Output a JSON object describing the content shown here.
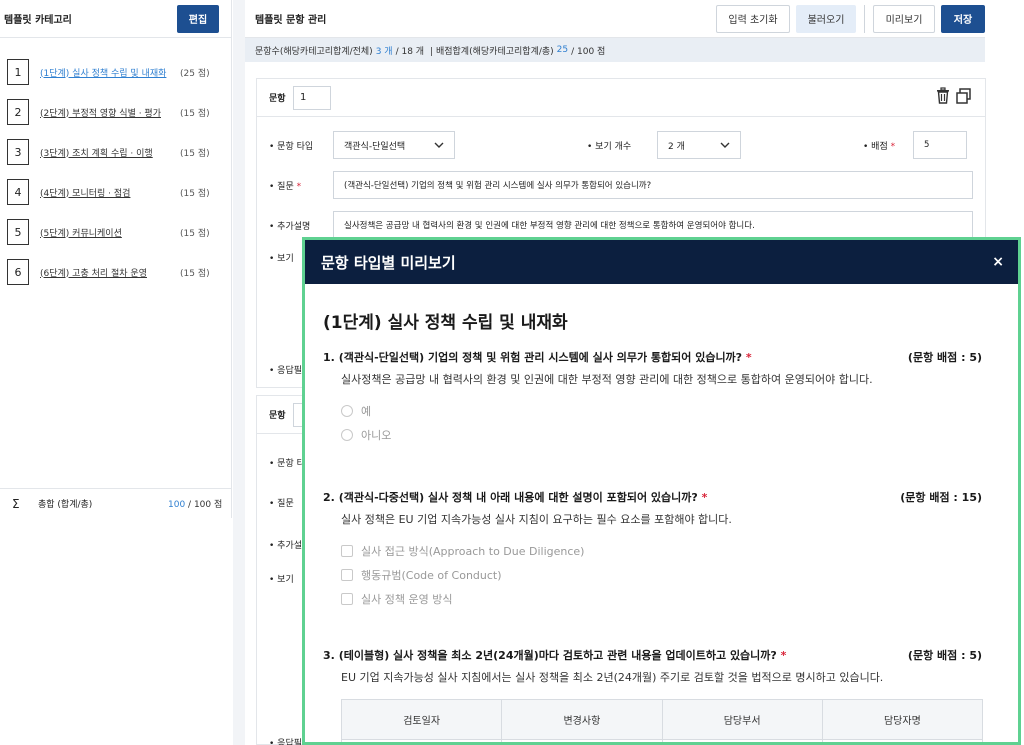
{
  "left": {
    "title": "템플릿 카테고리",
    "edit_label": "편집",
    "categories": [
      {
        "num": "1",
        "label": "(1단계) 실사 정책 수립 및 내재화",
        "score": "(25 점)"
      },
      {
        "num": "2",
        "label": "(2단계) 부정적 영향 식별 · 평가",
        "score": "(15 점)"
      },
      {
        "num": "3",
        "label": "(3단계) 조치 계획 수립 · 이행",
        "score": "(15 점)"
      },
      {
        "num": "4",
        "label": "(4단계) 모니터링 · 점검",
        "score": "(15 점)"
      },
      {
        "num": "5",
        "label": "(5단계) 커뮤니케이션",
        "score": "(15 점)"
      },
      {
        "num": "6",
        "label": "(6단계) 고충 처리 절차 운영",
        "score": "(15 점)"
      }
    ],
    "total_symbol": "Σ",
    "total_label": "총합 (합계/총)",
    "total_current": "100",
    "total_rest": " / 100 점"
  },
  "main": {
    "title": "템플릿 문항 관리",
    "btn_reset": "입력 초기화",
    "btn_load": "불러오기",
    "btn_preview": "미리보기",
    "btn_save": "저장",
    "summary": {
      "count_label": "문항수(해당카테고리합계/전체)",
      "count_current": "3 개",
      "count_rest": "/ 18 개",
      "score_label": "| 배점합계(해당카테고리합계/총)",
      "score_current": "25",
      "score_rest": "/ 100 점"
    },
    "question": {
      "num_label": "문항",
      "num_value": "1",
      "type_label": "• 문항 타입",
      "type_value": "객관식-단일선택",
      "options_label": "• 보기 개수",
      "options_value": "2 개",
      "score_label": "• 배점",
      "score_value": "5",
      "question_label": "• 질문",
      "question_value": "(객관식-단일선택) 기업의 정책 및 위험 관리 시스템에 실사 의무가 통합되어 있습니까?",
      "extra_label": "• 추가설명",
      "extra_value": "실사정책은 공급망 내 협력사의 환경 및 인권에 대한 부정적 영향 관리에 대한 정책으로 통합하여 운영되어야 합니다.",
      "view_label": "• 보기",
      "answer_label": "• 응답필"
    },
    "question2": {
      "num_label": "문항",
      "type_label": "• 문항 타",
      "question_label": "• 질문",
      "extra_label": "• 추가설",
      "view_label": "• 보기",
      "answer_label": "• 응답필"
    }
  },
  "modal": {
    "title": "문항 타입별 미리보기",
    "close": "×",
    "section_title": "(1단계) 실사 정책 수립 및 내재화",
    "questions": [
      {
        "num": "1.",
        "text": "(객관식-단일선택) 기업의 정책 및 위험 관리 시스템에 실사 의무가 통합되어 있습니까?",
        "req": "*",
        "score": "(문항 배점 : 5)",
        "desc": "실사정책은 공급망 내 협력사의 환경 및 인권에 대한 부정적 영향 관리에 대한 정책으로 통합하여 운영되어야 합니다.",
        "options": [
          "예",
          "아니오"
        ]
      },
      {
        "num": "2.",
        "text": "(객관식-다중선택) 실사 정책 내 아래 내용에 대한 설명이 포함되어 있습니까?",
        "req": "*",
        "score": "(문항 배점 : 15)",
        "desc": "실사 정책은 EU 기업 지속가능성 실사 지침이 요구하는 필수 요소를 포함해야 합니다.",
        "options": [
          "실사 접근 방식(Approach to Due Diligence)",
          "행동규범(Code of Conduct)",
          "실사 정책 운영 방식"
        ]
      },
      {
        "num": "3.",
        "text": "(테이블형) 실사 정책을 최소 2년(24개월)마다 검토하고 관련 내용을 업데이트하고 있습니까?",
        "req": "*",
        "score": "(문항 배점 : 5)",
        "desc": "EU 기업 지속가능성 실사 지침에서는 실사 정책을 최소 2년(24개월) 주기로 검토할 것을 법적으로 명시하고 있습니다.",
        "table_headers": [
          "검토일자",
          "변경사항",
          "담당부서",
          "담당자명"
        ]
      }
    ]
  }
}
